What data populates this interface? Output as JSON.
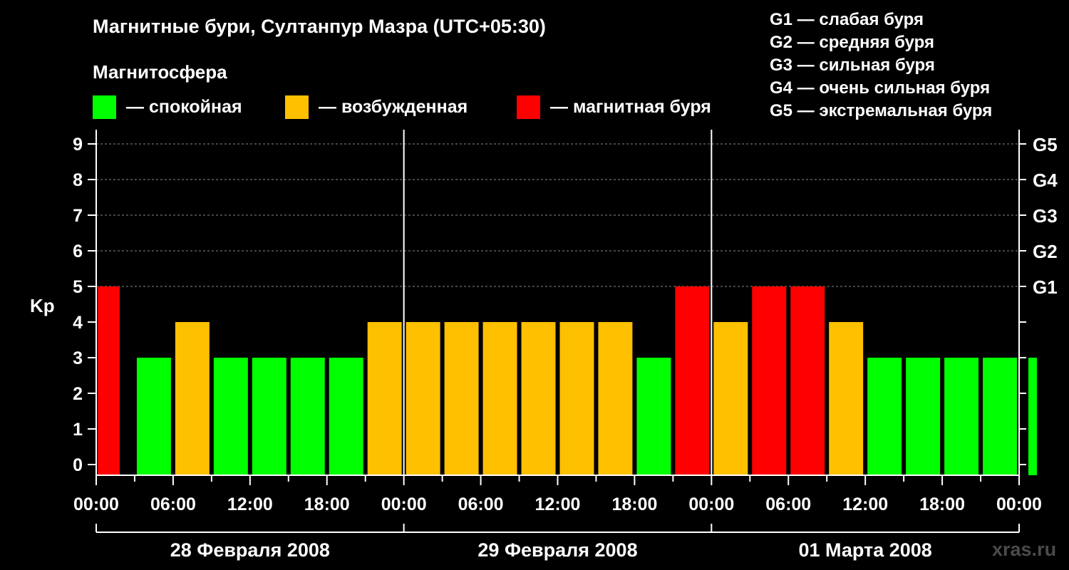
{
  "title": "Магнитные бури, Султанпур Мазра (UTC+05:30)",
  "legend": {
    "title": "Магнитосфера",
    "items": [
      {
        "label": "— спокойная",
        "color": "#00ff00"
      },
      {
        "label": "— возбужденная",
        "color": "#ffc000"
      },
      {
        "label": "— магнитная буря",
        "color": "#ff0000"
      }
    ]
  },
  "g_scale": [
    "G1 — слабая буря",
    "G2 — средняя буря",
    "G3 — сильная буря",
    "G4 — очень сильная буря",
    "G5 — экстремальная буря"
  ],
  "watermark": "xras.ru",
  "chart_data": {
    "type": "bar",
    "ylabel": "Kp",
    "ylim": [
      0,
      9
    ],
    "y_ticks": [
      "0",
      "1",
      "2",
      "3",
      "4",
      "5",
      "6",
      "7",
      "8",
      "9"
    ],
    "right_ticks": [
      {
        "kp": 5,
        "label": "G1"
      },
      {
        "kp": 6,
        "label": "G2"
      },
      {
        "kp": 7,
        "label": "G3"
      },
      {
        "kp": 8,
        "label": "G4"
      },
      {
        "kp": 9,
        "label": "G5"
      }
    ],
    "grid": true,
    "x_tick_labels": [
      "00:00",
      "06:00",
      "12:00",
      "18:00",
      "00:00",
      "06:00",
      "12:00",
      "18:00",
      "00:00",
      "06:00",
      "12:00",
      "18:00",
      "00:00"
    ],
    "days": [
      "28 Февраля 2008",
      "29 Февраля 2008",
      "01 Марта 2008"
    ],
    "bar_hours": 3,
    "bars": [
      {
        "start_hour": 0,
        "duration": 1.5,
        "kp": 5
      },
      {
        "start_hour": 4.5,
        "kp": 3
      },
      {
        "start_hour": 7.5,
        "kp": 4
      },
      {
        "start_hour": 10.5,
        "kp": 3
      },
      {
        "start_hour": 13.5,
        "kp": 3
      },
      {
        "start_hour": 16.5,
        "kp": 3
      },
      {
        "start_hour": 19.5,
        "kp": 3
      },
      {
        "start_hour": 22.5,
        "kp": 4
      },
      {
        "start_hour": 25.5,
        "kp": 4
      },
      {
        "start_hour": 28.5,
        "kp": 4
      },
      {
        "start_hour": 31.5,
        "kp": 4
      },
      {
        "start_hour": 34.5,
        "kp": 4
      },
      {
        "start_hour": 37.5,
        "kp": 4
      },
      {
        "start_hour": 40.5,
        "kp": 4
      },
      {
        "start_hour": 43.5,
        "kp": 3
      },
      {
        "start_hour": 46.5,
        "kp": 5
      },
      {
        "start_hour": 49.5,
        "kp": 4
      },
      {
        "start_hour": 52.5,
        "kp": 5
      },
      {
        "start_hour": 55.5,
        "kp": 5
      },
      {
        "start_hour": 58.5,
        "kp": 4
      },
      {
        "start_hour": 61.5,
        "kp": 3
      },
      {
        "start_hour": 64.5,
        "kp": 3
      },
      {
        "start_hour": 67.5,
        "kp": 3
      },
      {
        "start_hour": 70.5,
        "kp": 3
      },
      {
        "start_hour": 73.5,
        "duration": 1,
        "kp": 3
      }
    ]
  }
}
